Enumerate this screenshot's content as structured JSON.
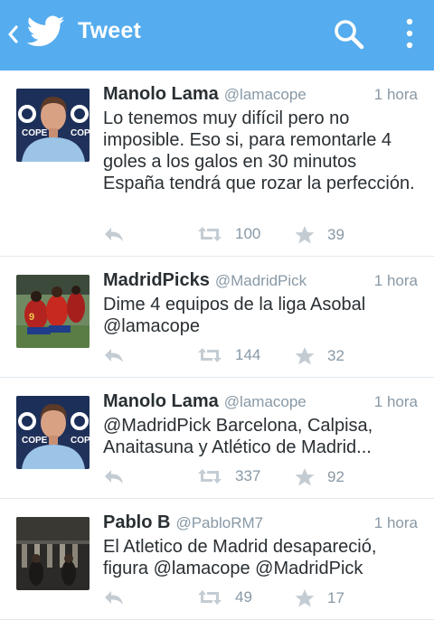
{
  "header": {
    "title": "Tweet",
    "bg_color": "#55acee",
    "back_icon": "chevron-left-icon",
    "logo_icon": "twitter-bird-icon",
    "search_icon": "search-icon",
    "overflow_icon": "more-vertical-icon"
  },
  "tweets": [
    {
      "name": "Manolo Lama",
      "handle": "@lamacope",
      "time": "1 hora",
      "text": "Lo tenemos muy difícil pero no imposible. Eso si, para remontarle 4 goles a los galos en 30 minutos España tendrá que rozar la perfección.",
      "retweets": "100",
      "favorites": "39"
    },
    {
      "name": "MadridPicks",
      "handle": "@MadridPick",
      "time": "1 hora",
      "text": "Dime 4 equipos de la liga Asobal @lamacope",
      "retweets": "144",
      "favorites": "32"
    },
    {
      "name": "Manolo Lama",
      "handle": "@lamacope",
      "time": "1 hora",
      "text": "@MadridPick Barcelona, Calpisa, Anaitasuna y Atlético de Madrid...",
      "retweets": "337",
      "favorites": "92"
    },
    {
      "name": "Pablo B",
      "handle": "@PabloRM7",
      "time": "1 hora",
      "text": "El Atletico de Madrid desapareció, figura @lamacope @MadridPick",
      "retweets": "49",
      "favorites": "17"
    }
  ]
}
